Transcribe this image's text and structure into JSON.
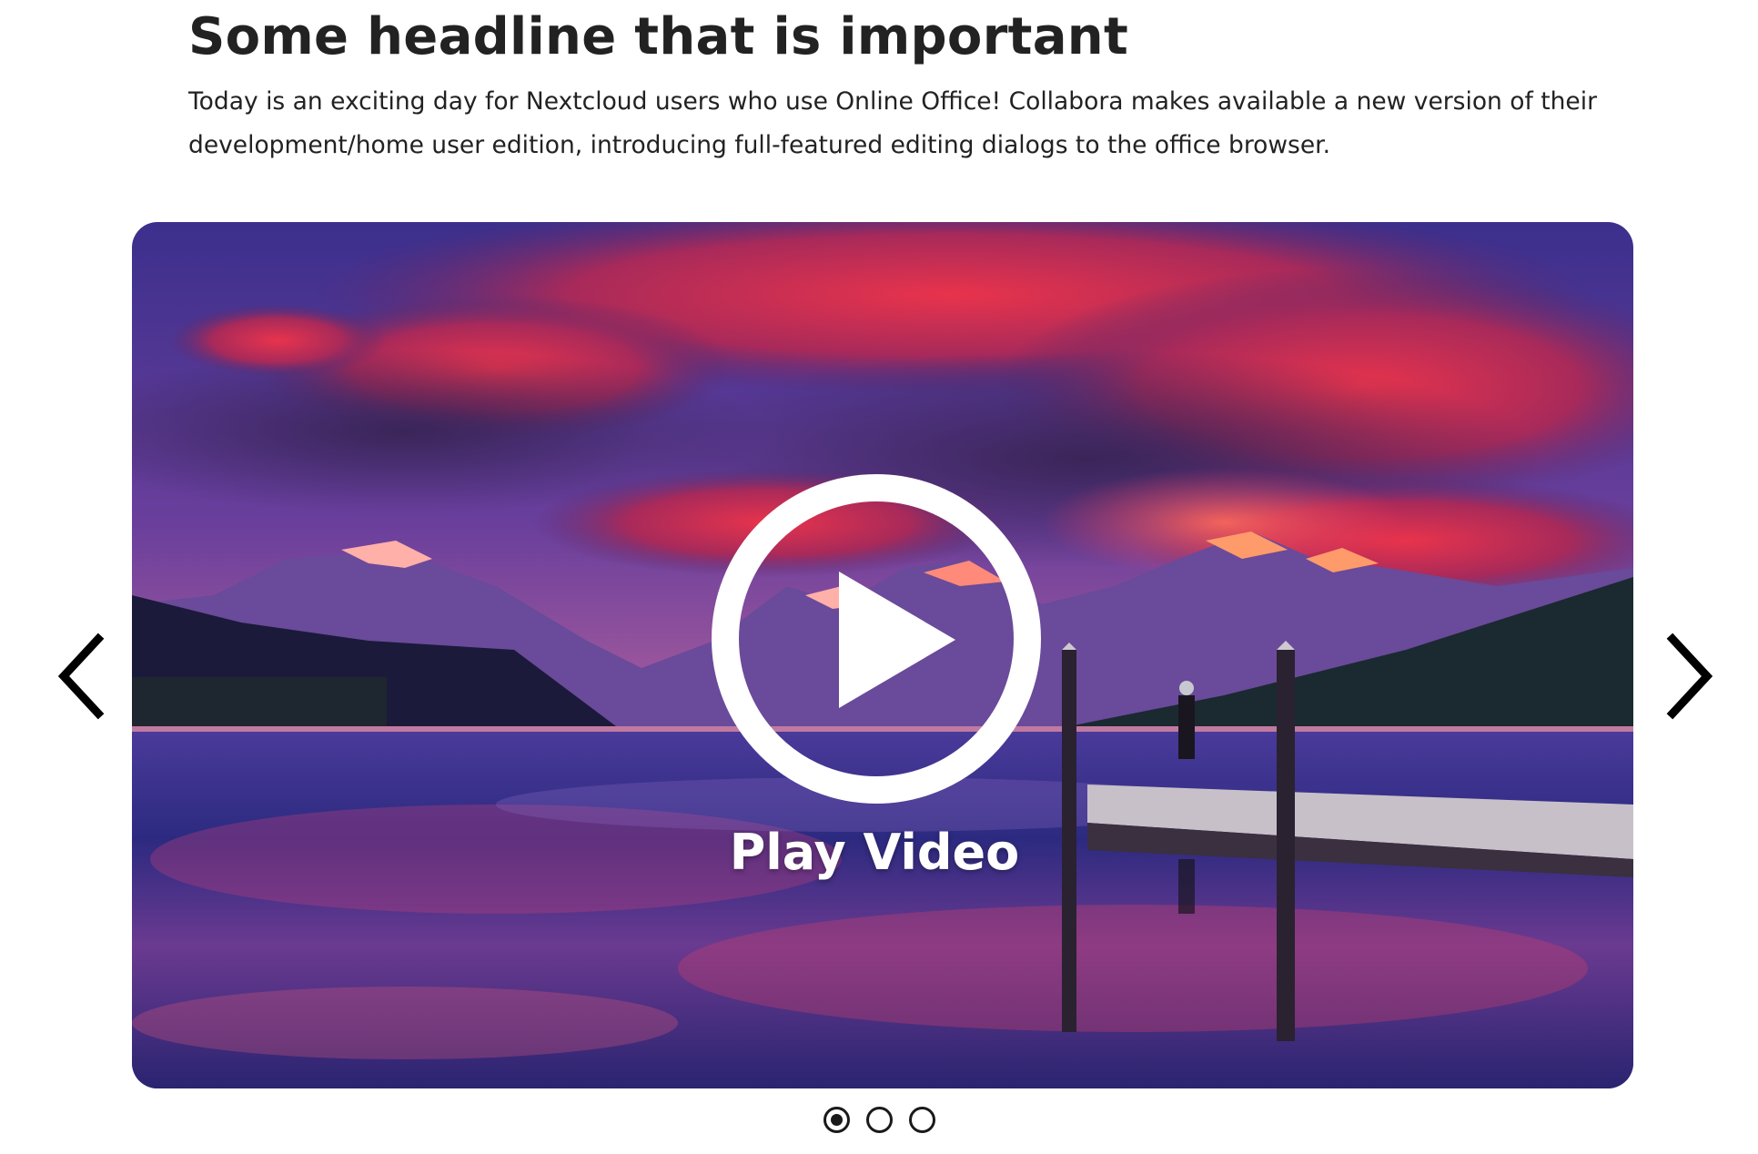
{
  "article": {
    "headline": "Some headline that is important",
    "lead": "Today is an exciting day for Nextcloud users who use Online Office! Collabora makes available a new version of their development/home user edition, introducing full-featured editing dialogs to the office browser."
  },
  "carousel": {
    "play_label": "Play Video",
    "prev_icon": "chevron-left-icon",
    "next_icon": "chevron-right-icon",
    "slide_count": 3,
    "active_index": 0
  },
  "colors": {
    "text": "#222222",
    "overlay_white": "#ffffff",
    "sky_top": "#3a2f86",
    "cloud_red": "#e0304e",
    "water": "#2a2a7a"
  }
}
